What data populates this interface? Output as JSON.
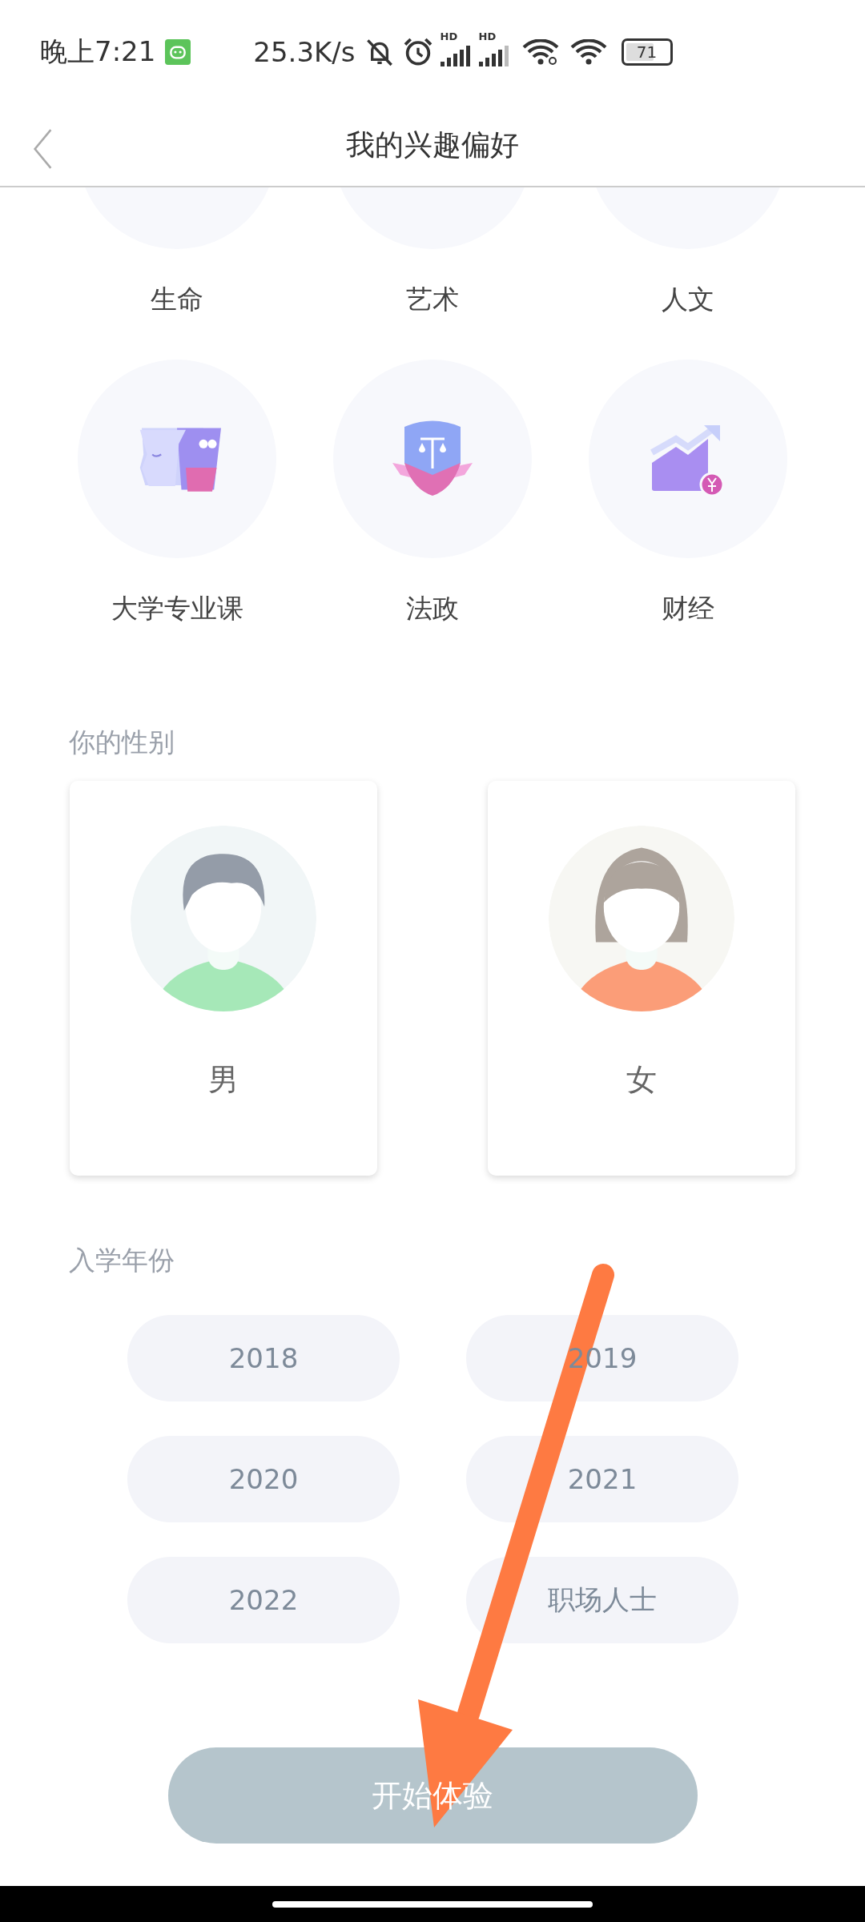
{
  "status_bar": {
    "time": "晚上7:21",
    "speed": "25.3K/s",
    "signal_labels": [
      "HD",
      "HD"
    ],
    "battery": "71"
  },
  "nav": {
    "title": "我的兴趣偏好"
  },
  "categories": [
    {
      "label": "生命"
    },
    {
      "label": "艺术"
    },
    {
      "label": "人文"
    },
    {
      "label": "大学专业课"
    },
    {
      "label": "法政"
    },
    {
      "label": "财经"
    }
  ],
  "gender": {
    "heading": "你的性别",
    "options": [
      {
        "label": "男",
        "kind": "male"
      },
      {
        "label": "女",
        "kind": "female"
      }
    ]
  },
  "year": {
    "heading": "入学年份",
    "options": [
      {
        "label": "2018"
      },
      {
        "label": "2019"
      },
      {
        "label": "2020"
      },
      {
        "label": "2021"
      },
      {
        "label": "2022"
      },
      {
        "label": "职场人士"
      }
    ]
  },
  "start_button": {
    "label": "开始体验",
    "disabled": true
  }
}
